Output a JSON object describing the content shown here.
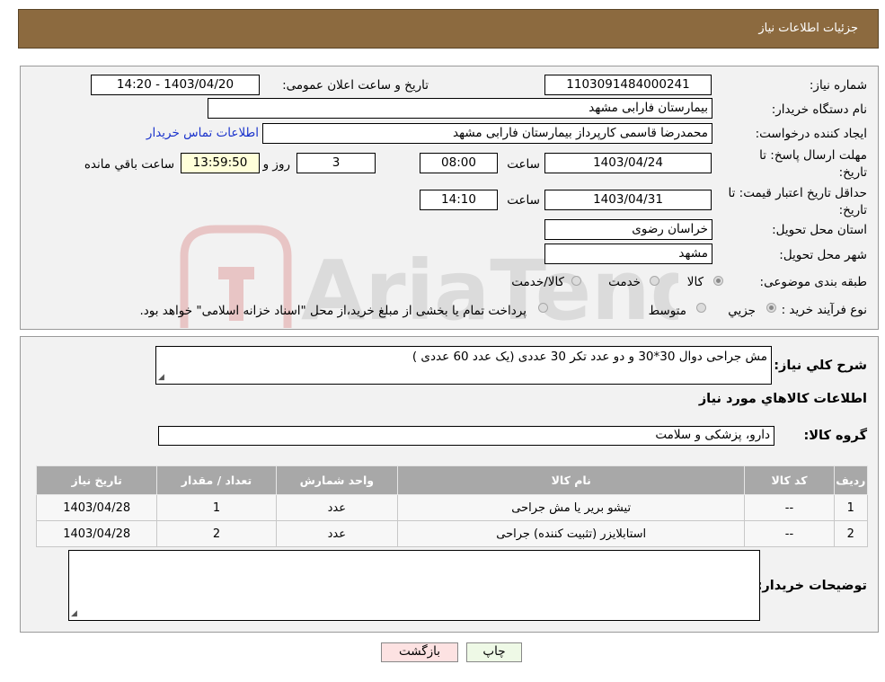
{
  "header": {
    "title": "جزئیات اطلاعات نیاز"
  },
  "form": {
    "need_number_label": "شماره نیاز:",
    "need_number": "1103091484000241",
    "announce_label": "تاریخ و ساعت اعلان عمومی:",
    "announce_value": "1403/04/20 - 14:20",
    "buyer_org_label": "نام دستگاه خریدار:",
    "buyer_org": "بیمارستان فارابی مشهد",
    "requester_label": "ایجاد کننده درخواست:",
    "requester": "محمدرضا قاسمی کارپرداز بیمارستان فارابی مشهد",
    "contact_link": "اطلاعات تماس خریدار",
    "deadline_label_1": "مهلت ارسال پاسخ: تا",
    "deadline_label_2": "تاریخ:",
    "deadline_date": "1403/04/24",
    "time_label": "ساعت",
    "deadline_time": "08:00",
    "days_value": "3",
    "days_label": "روز و",
    "remaining_time": "13:59:50",
    "remaining_label": "ساعت باقي مانده",
    "validity_label_1": "حداقل تاریخ اعتبار قیمت: تا",
    "validity_label_2": "تاریخ:",
    "validity_date": "1403/04/31",
    "validity_time": "14:10",
    "province_label": "استان محل تحویل:",
    "province": "خراسان رضوی",
    "city_label": "شهر محل تحویل:",
    "city": "مشهد",
    "category_label": "طبقه بندی موضوعی:",
    "category_options": [
      "کالا",
      "خدمت",
      "کالا/خدمت"
    ],
    "purchase_type_label": "نوع فرآیند خرید :",
    "purchase_options": [
      "جزیي",
      "متوسط"
    ],
    "purchase_note": "پرداخت تمام یا بخشی از مبلغ خرید،از محل \"اسناد خزانه اسلامی\" خواهد بود."
  },
  "details": {
    "summary_label": "شرح کلي نیاز:",
    "summary": "مش جراحی دوال 30*30 و دو عدد تکر 30 عددی (یک عدد 60 عددی )",
    "goods_info_title": "اطلاعات کالاهاي مورد نیاز",
    "group_label": "گروه کالا:",
    "group_value": "دارو، پزشکی و سلامت",
    "table": {
      "headers": [
        "ردیف",
        "کد کالا",
        "نام کالا",
        "واحد شمارش",
        "تعداد / مقدار",
        "تاریخ نیاز"
      ],
      "rows": [
        [
          "1",
          "--",
          "تیشو بریر یا مش جراحی",
          "عدد",
          "1",
          "1403/04/28"
        ],
        [
          "2",
          "--",
          "استابلایزر (تثبیت کننده) جراحی",
          "عدد",
          "2",
          "1403/04/28"
        ]
      ]
    },
    "buyer_notes_label": "توضیحات خریدار:"
  },
  "buttons": {
    "print": "چاپ",
    "back": "بازگشت"
  },
  "watermark": {
    "text": "AriaTender.neT"
  }
}
